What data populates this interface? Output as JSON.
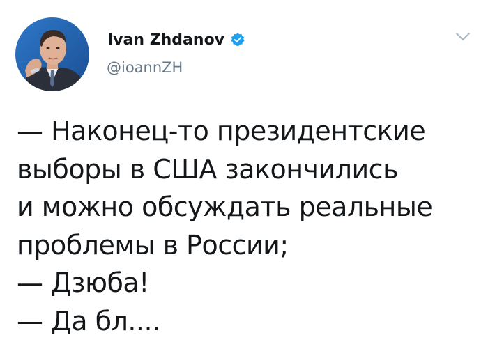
{
  "author": {
    "display_name": "Ivan Zhdanov",
    "handle": "@ioannZH",
    "verified": true
  },
  "tweet": {
    "lines": [
      "— Наконец-то президентские",
      "выборы в США закончились",
      "и можно обсуждать реальные",
      "проблемы в России;",
      "— Дзюба!",
      "— Да бл...."
    ]
  },
  "icons": {
    "verified": "verified-badge-icon",
    "menu": "chevron-down-icon"
  },
  "colors": {
    "text": "#14171a",
    "secondary": "#657786",
    "verified": "#1da1f2",
    "caret": "#aab8c2"
  }
}
